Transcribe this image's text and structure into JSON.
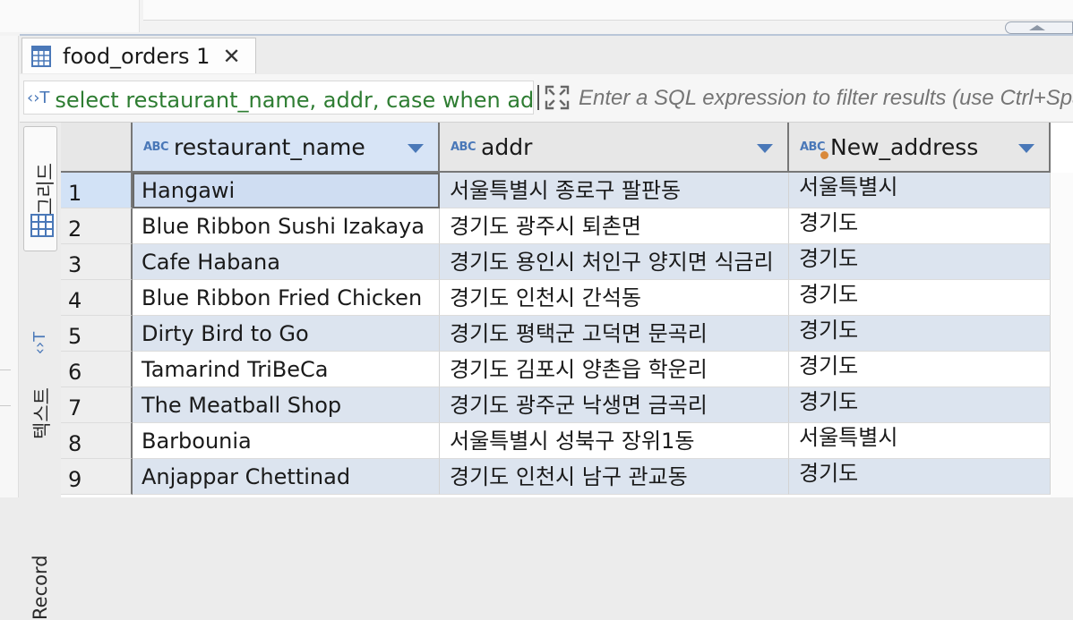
{
  "tab": {
    "title": "food_orders 1",
    "close": "✕"
  },
  "filter": {
    "query_icon": "‹›T",
    "query": "select restaurant_name, addr, case when addr like '%서울%' then '서울특별시' else '경기도' end New_address from food_orders fo",
    "placeholder": "Enter a SQL expression to filter results (use Ctrl+Space)"
  },
  "switcher": {
    "grid": "그리드",
    "text": "텍스트",
    "record": "Record"
  },
  "columns": [
    {
      "type": "ABC",
      "name": "restaurant_name"
    },
    {
      "type": "ABC",
      "name": "addr"
    },
    {
      "type": "ABC",
      "name": "New_address"
    }
  ],
  "rows": [
    {
      "n": "1",
      "name": "Hangawi",
      "addr": "서울특별시 종로구 팔판동",
      "new": "서울특별시"
    },
    {
      "n": "2",
      "name": "Blue Ribbon Sushi Izakaya",
      "addr": "경기도 광주시 퇴촌면",
      "new": "경기도"
    },
    {
      "n": "3",
      "name": "Cafe Habana",
      "addr": "경기도 용인시 처인구 양지면 식금리",
      "new": "경기도"
    },
    {
      "n": "4",
      "name": "Blue Ribbon Fried Chicken",
      "addr": "경기도 인천시 간석동",
      "new": "경기도"
    },
    {
      "n": "5",
      "name": "Dirty Bird to Go",
      "addr": "경기도 평택군 고덕면 문곡리",
      "new": "경기도"
    },
    {
      "n": "6",
      "name": "Tamarind TriBeCa",
      "addr": "경기도 김포시 양촌읍 학운리",
      "new": "경기도"
    },
    {
      "n": "7",
      "name": "The Meatball Shop",
      "addr": "경기도 광주군 낙생면 금곡리",
      "new": "경기도"
    },
    {
      "n": "8",
      "name": "Barbounia",
      "addr": "서울특별시 성북구 장위1동",
      "new": "서울특별시"
    },
    {
      "n": "9",
      "name": "Anjappar Chettinad",
      "addr": "경기도 인천시 남구 관교동",
      "new": "경기도"
    }
  ],
  "colors": {
    "accent": "#4a78b8",
    "query_green": "#2e7d32",
    "selection": "#cfddf2",
    "alt_row": "#dce4ef"
  }
}
